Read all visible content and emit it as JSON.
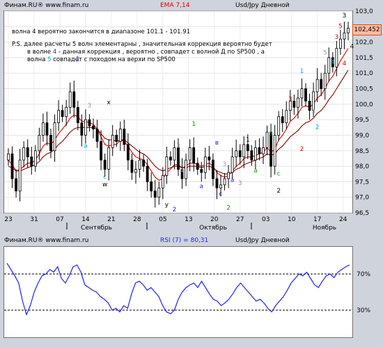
{
  "main_header": {
    "source": "Финам.RU® www.finam.ru",
    "indicator": "EMA 7,14",
    "instrument": "Usd/Jpy Дневной"
  },
  "rsi_header": {
    "source": "Финам.RU® www.finam.ru",
    "indicator": "RSI (7) = 80,31",
    "instrument": "Usd/Jpy Дневной"
  },
  "notes": {
    "line1": "волна 4 вероятно закончится в диапазоне 101.1  -  101.91",
    "line2": "P.S. далее  расчеты 5 волн элементарны , значительная коррекция вероятно будет",
    "line3a": "в волне ",
    "line3b": "4",
    "line3c": "  - данная коррекция , вероятно , совпадет  с  волной Д  по SP500 , а",
    "line4a": "волна ",
    "line4b": "5",
    "line4c": " совпадет с походом на верхи по SP500"
  },
  "price_tag": "102,452",
  "colors": {
    "candle": "#000000",
    "ema_fast": "#e00000",
    "ema_slow": "#8a0000",
    "rsi_line": "#2020ff",
    "wave_blue": "#2222dd",
    "wave_cyan": "#00aadd",
    "wave_green": "#00a000",
    "wave_red": "#e00000",
    "wave_gray": "#999999"
  },
  "chart_data": [
    {
      "type": "candlestick",
      "title": "Usd/Jpy Дневной",
      "y_ticks": [
        "96,5",
        "97,0",
        "97,5",
        "98,0",
        "98,5",
        "99,0",
        "99,5",
        "100,0",
        "100,5",
        "101,0",
        "101,5",
        "102,0",
        "102,5",
        "103,0"
      ],
      "ylim": [
        96.5,
        103.0
      ],
      "x_tick_labels": [
        "23",
        "31",
        "07",
        "14",
        "21",
        "28",
        "05",
        "13",
        "20",
        "27",
        "03",
        "10",
        "17",
        "24"
      ],
      "month_labels": [
        "Сентябрь",
        "Октябрь",
        "Ноябрь"
      ],
      "grid": true,
      "close": [
        98.4,
        97.6,
        97.2,
        98.2,
        98.6,
        98.3,
        98.0,
        98.5,
        99.0,
        99.4,
        99.0,
        98.5,
        99.4,
        99.8,
        99.6,
        99.9,
        100.4,
        99.9,
        99.4,
        99.0,
        99.5,
        99.3,
        99.2,
        98.8,
        98.2,
        97.9,
        98.6,
        99.0,
        98.8,
        99.2,
        98.7,
        98.2,
        97.8,
        97.9,
        98.2,
        98.0,
        97.5,
        97.2,
        97.0,
        97.3,
        97.7,
        98.3,
        98.2,
        98.6,
        97.9,
        97.6,
        98.2,
        98.6,
        98.1,
        97.9,
        97.8,
        98.3,
        98.2,
        97.6,
        97.3,
        97.4,
        97.6,
        97.8,
        98.3,
        98.5,
        98.3,
        98.7,
        98.5,
        98.2,
        98.6,
        98.4,
        98.6,
        99.1,
        98.0,
        99.0,
        99.6,
        99.4,
        99.8,
        100.1,
        99.9,
        100.2,
        100.5,
        100.1,
        99.8,
        100.4,
        100.8,
        100.5,
        101.0,
        101.5,
        101.2,
        101.8,
        102.1,
        102.3,
        102.45
      ],
      "series": [
        {
          "name": "EMA 7",
          "values": [
            98.2,
            98.05,
            97.85,
            97.9,
            98.0,
            98.1,
            98.1,
            98.2,
            98.4,
            98.65,
            98.75,
            98.7,
            98.85,
            99.05,
            99.2,
            99.35,
            99.55,
            99.65,
            99.6,
            99.45,
            99.45,
            99.4,
            99.35,
            99.2,
            98.95,
            98.7,
            98.65,
            98.7,
            98.7,
            98.85,
            98.8,
            98.65,
            98.45,
            98.3,
            98.25,
            98.2,
            98.05,
            97.85,
            97.65,
            97.55,
            97.6,
            97.8,
            97.9,
            98.05,
            98.05,
            97.95,
            98.0,
            98.1,
            98.1,
            98.05,
            98.0,
            98.05,
            98.1,
            98.0,
            97.8,
            97.7,
            97.65,
            97.7,
            97.85,
            98.0,
            98.1,
            98.25,
            98.3,
            98.3,
            98.35,
            98.4,
            98.45,
            98.6,
            98.45,
            98.55,
            98.85,
            99.0,
            99.2,
            99.45,
            99.55,
            99.7,
            99.9,
            99.95,
            99.9,
            100.0,
            100.2,
            100.3,
            100.5,
            100.75,
            100.9,
            101.15,
            101.4,
            101.6,
            101.8
          ]
        },
        {
          "name": "EMA 14",
          "values": [
            98.0,
            97.95,
            97.85,
            97.85,
            97.9,
            97.95,
            98.0,
            98.05,
            98.15,
            98.3,
            98.4,
            98.45,
            98.55,
            98.7,
            98.8,
            98.95,
            99.1,
            99.2,
            99.25,
            99.25,
            99.25,
            99.25,
            99.25,
            99.2,
            99.05,
            98.9,
            98.85,
            98.85,
            98.8,
            98.85,
            98.85,
            98.75,
            98.65,
            98.55,
            98.45,
            98.4,
            98.3,
            98.15,
            98.0,
            97.9,
            97.85,
            97.9,
            97.95,
            98.0,
            98.0,
            97.95,
            97.95,
            98.0,
            98.0,
            98.0,
            97.95,
            98.0,
            98.0,
            97.95,
            97.85,
            97.8,
            97.75,
            97.75,
            97.8,
            97.9,
            97.95,
            98.05,
            98.1,
            98.15,
            98.2,
            98.25,
            98.3,
            98.4,
            98.35,
            98.4,
            98.55,
            98.65,
            98.8,
            98.95,
            99.05,
            99.15,
            99.3,
            99.4,
            99.45,
            99.55,
            99.7,
            99.8,
            99.95,
            100.15,
            100.3,
            100.5,
            100.7,
            100.9,
            101.1
          ]
        }
      ],
      "wave_labels": [
        {
          "text": "1",
          "color": "blue",
          "i": 18,
          "price": 101.4
        },
        {
          "text": "3",
          "color": "gray",
          "i": 21,
          "price": 99.9
        },
        {
          "text": "x",
          "color": "black",
          "i": 26,
          "price": 100.0
        },
        {
          "text": "a",
          "color": "cyan",
          "i": 20,
          "price": 98.6
        },
        {
          "text": "c",
          "color": "cyan",
          "i": 25,
          "price": 97.6
        },
        {
          "text": "w",
          "color": "black",
          "i": 25,
          "price": 97.35
        },
        {
          "text": "y",
          "color": "black",
          "i": 41,
          "price": 96.7
        },
        {
          "text": "2",
          "color": "blue",
          "i": 43,
          "price": 96.55
        },
        {
          "text": "1",
          "color": "green",
          "i": 48,
          "price": 99.3
        },
        {
          "text": "3",
          "color": "gray",
          "i": 44,
          "price": 98.6
        },
        {
          "text": "4",
          "color": "gray",
          "i": 45,
          "price": 97.8
        },
        {
          "text": "в",
          "color": "blue",
          "i": 54,
          "price": 98.7
        },
        {
          "text": "a",
          "color": "blue",
          "i": 50,
          "price": 97.3
        },
        {
          "text": "c",
          "color": "blue",
          "i": 55,
          "price": 97.05
        },
        {
          "text": "2",
          "color": "green",
          "i": 57,
          "price": 96.6
        },
        {
          "text": "3",
          "color": "gray",
          "i": 56,
          "price": 98.0
        },
        {
          "text": "a",
          "color": "blue",
          "i": 58,
          "price": 97.5
        },
        {
          "text": "a",
          "color": "green",
          "i": 64,
          "price": 97.8
        },
        {
          "text": "1",
          "color": "black",
          "i": 62,
          "price": 98.8
        },
        {
          "text": "3",
          "color": "gray",
          "i": 60,
          "price": 97.4
        },
        {
          "text": "в",
          "color": "green",
          "i": 68,
          "price": 99.0
        },
        {
          "text": "c",
          "color": "green",
          "i": 70,
          "price": 97.7
        },
        {
          "text": "2",
          "color": "black",
          "i": 70,
          "price": 97.15
        },
        {
          "text": "3",
          "color": "red",
          "i": 73,
          "price": 100.1
        },
        {
          "text": "1",
          "color": "cyan",
          "i": 76,
          "price": 101.0
        },
        {
          "text": "2",
          "color": "red",
          "i": 76,
          "price": 98.5
        },
        {
          "text": "2",
          "color": "cyan",
          "i": 80,
          "price": 99.2
        },
        {
          "text": "3",
          "color": "gray",
          "i": 79,
          "price": 99.7
        },
        {
          "text": "4",
          "color": "cyan",
          "i": 84,
          "price": 101.3
        },
        {
          "text": "5",
          "color": "gray",
          "i": 82,
          "price": 101.6
        },
        {
          "text": "3",
          "color": "red",
          "i": 85,
          "price": 102.1
        },
        {
          "text": "4",
          "color": "red",
          "i": 87,
          "price": 101.25
        },
        {
          "text": "5",
          "color": "red",
          "i": 86,
          "price": 102.45
        },
        {
          "text": "3",
          "color": "black",
          "i": 87,
          "price": 102.8
        },
        {
          "text": "4",
          "color": "black",
          "i": 89,
          "price": 101.8
        }
      ]
    },
    {
      "type": "line",
      "title": "RSI (7) = 80,31",
      "ylim": [
        0,
        100
      ],
      "y_ticks": [
        "70%",
        "30%"
      ],
      "reference_lines": [
        70,
        30
      ],
      "series": [
        {
          "name": "RSI (7)",
          "values": [
            82,
            75,
            68,
            60,
            40,
            25,
            35,
            50,
            60,
            68,
            70,
            75,
            72,
            78,
            65,
            60,
            68,
            78,
            80,
            72,
            58,
            55,
            52,
            50,
            45,
            42,
            38,
            30,
            32,
            28,
            35,
            32,
            48,
            60,
            62,
            58,
            52,
            55,
            50,
            45,
            35,
            28,
            26,
            30,
            42,
            50,
            55,
            58,
            60,
            55,
            62,
            55,
            48,
            42,
            40,
            35,
            38,
            42,
            48,
            55,
            60,
            55,
            50,
            45,
            40,
            42,
            38,
            32,
            28,
            35,
            40,
            45,
            52,
            60,
            65,
            70,
            68,
            72,
            65,
            58,
            55,
            62,
            68,
            70,
            66,
            72,
            75,
            78,
            80
          ]
        }
      ]
    }
  ]
}
